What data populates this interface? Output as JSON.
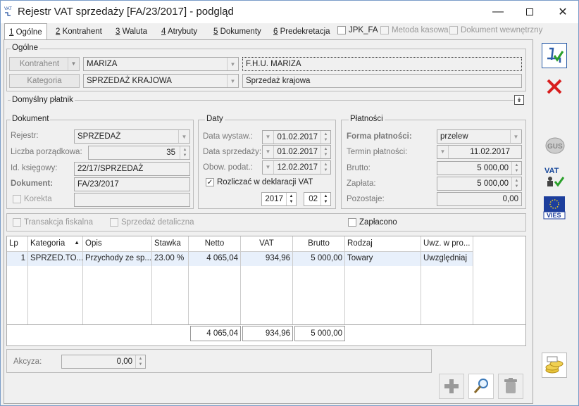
{
  "window": {
    "title": "Rejestr VAT sprzedaży [FA/23/2017] - podgląd",
    "icon_text": "VAT"
  },
  "tabs": [
    {
      "key": "1",
      "label": " Ogólne"
    },
    {
      "key": "2",
      "label": " Kontrahent"
    },
    {
      "key": "3",
      "label": " Waluta"
    },
    {
      "key": "4",
      "label": " Atrybuty"
    },
    {
      "key": "5",
      "label": " Dokumenty"
    },
    {
      "key": "6",
      "label": " Predekretacja"
    }
  ],
  "header_checks": {
    "jpk": "JPK_FA",
    "metoda": "Metoda kasowa",
    "dokument": "Dokument wewnętrzny"
  },
  "ogolne": {
    "group": "Ogólne",
    "kontrahent_btn": "Kontrahent",
    "kontrahent_code": "MARIZA",
    "kontrahent_name": "F.H.U. MARIZA",
    "kategoria_btn": "Kategoria",
    "kategoria_code": "SPRZEDAŻ KRAJOWA",
    "kategoria_desc": "Sprzedaż krajowa"
  },
  "platnik": {
    "label": "Domyślny płatnik"
  },
  "dokument": {
    "group": "Dokument",
    "rejestr_label": "Rejestr:",
    "rejestr_value": "SPRZEDAŻ",
    "lp_label": "Liczba porządkowa:",
    "lp_value": "35",
    "id_label": "Id. księgowy:",
    "id_value": "22/17/SPRZEDAŻ",
    "dok_label": "Dokument:",
    "dok_value": "FA/23/2017",
    "korekta_label": "Korekta"
  },
  "daty": {
    "group": "Daty",
    "wystaw_label": "Data wystaw.:",
    "wystaw_value": "01.02.2017",
    "sprzed_label": "Data sprzedaży:",
    "sprzed_value": "01.02.2017",
    "obow_label": "Obow. podat.:",
    "obow_value": "12.02.2017",
    "rozliczac_label": "Rozliczać w deklaracji VAT",
    "rok": "2017",
    "miesiac": "02"
  },
  "platnosci": {
    "group": "Płatności",
    "forma_label": "Forma płatności:",
    "forma_value": "przelew",
    "termin_label": "Termin płatności:",
    "termin_value": "11.02.2017",
    "brutto_label": "Brutto:",
    "brutto_value": "5 000,00",
    "zaplata_label": "Zapłata:",
    "zaplata_value": "5 000,00",
    "pozostaje_label": "Pozostaje:",
    "pozostaje_value": "0,00"
  },
  "options": {
    "fiskalna": "Transakcja fiskalna",
    "detaliczna": "Sprzedaż detaliczna",
    "zaplacono": "Zapłacono"
  },
  "table": {
    "columns": [
      "Lp",
      "Kategoria",
      "Opis",
      "Stawka",
      "Netto",
      "VAT",
      "Brutto",
      "Rodzaj",
      "Uwz. w pro..."
    ],
    "rows": [
      [
        "1",
        "SPRZED.TO...",
        "Przychody ze sp...",
        "23.00 %",
        "4 065,04",
        "934,96",
        "5 000,00",
        "Towary",
        "Uwzględniaj"
      ]
    ],
    "totals": {
      "netto": "4 065,04",
      "vat": "934,96",
      "brutto": "5 000,00"
    }
  },
  "akcyza": {
    "label": "Akcyza:",
    "value": "0,00"
  },
  "side_buttons": {
    "gus": "GUS",
    "vat": "VAT",
    "vies": "VIES"
  }
}
